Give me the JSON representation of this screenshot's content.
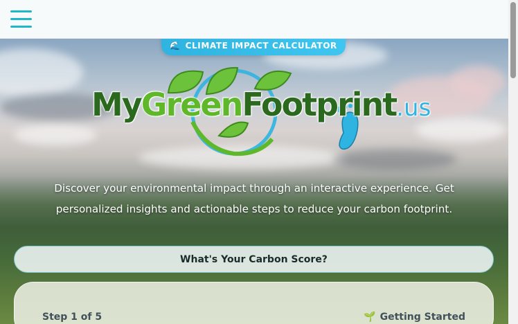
{
  "header": {
    "menu_icon": "hamburger-menu-icon"
  },
  "hero": {
    "badge_icon": "globe-icon",
    "badge_label": "CLIMATE IMPACT CALCULATOR",
    "logo": {
      "part_my": "My",
      "part_green": "Green",
      "part_footprint": "Footprint",
      "part_tld": ".us"
    },
    "description": "Discover your environmental impact through an interactive experience. Get personalized insights and actionable steps to reduce your carbon footprint.",
    "cta_label": "What's Your Carbon Score?"
  },
  "quiz_card": {
    "step_label": "Step 1 of 5",
    "stage_icon": "sprout-icon",
    "stage_label": "Getting Started"
  },
  "colors": {
    "accent": "#1fb6c9",
    "badge": "#2fb3e0",
    "logo_dark_green": "#2b6a1e",
    "logo_light_green": "#5fb82a"
  }
}
